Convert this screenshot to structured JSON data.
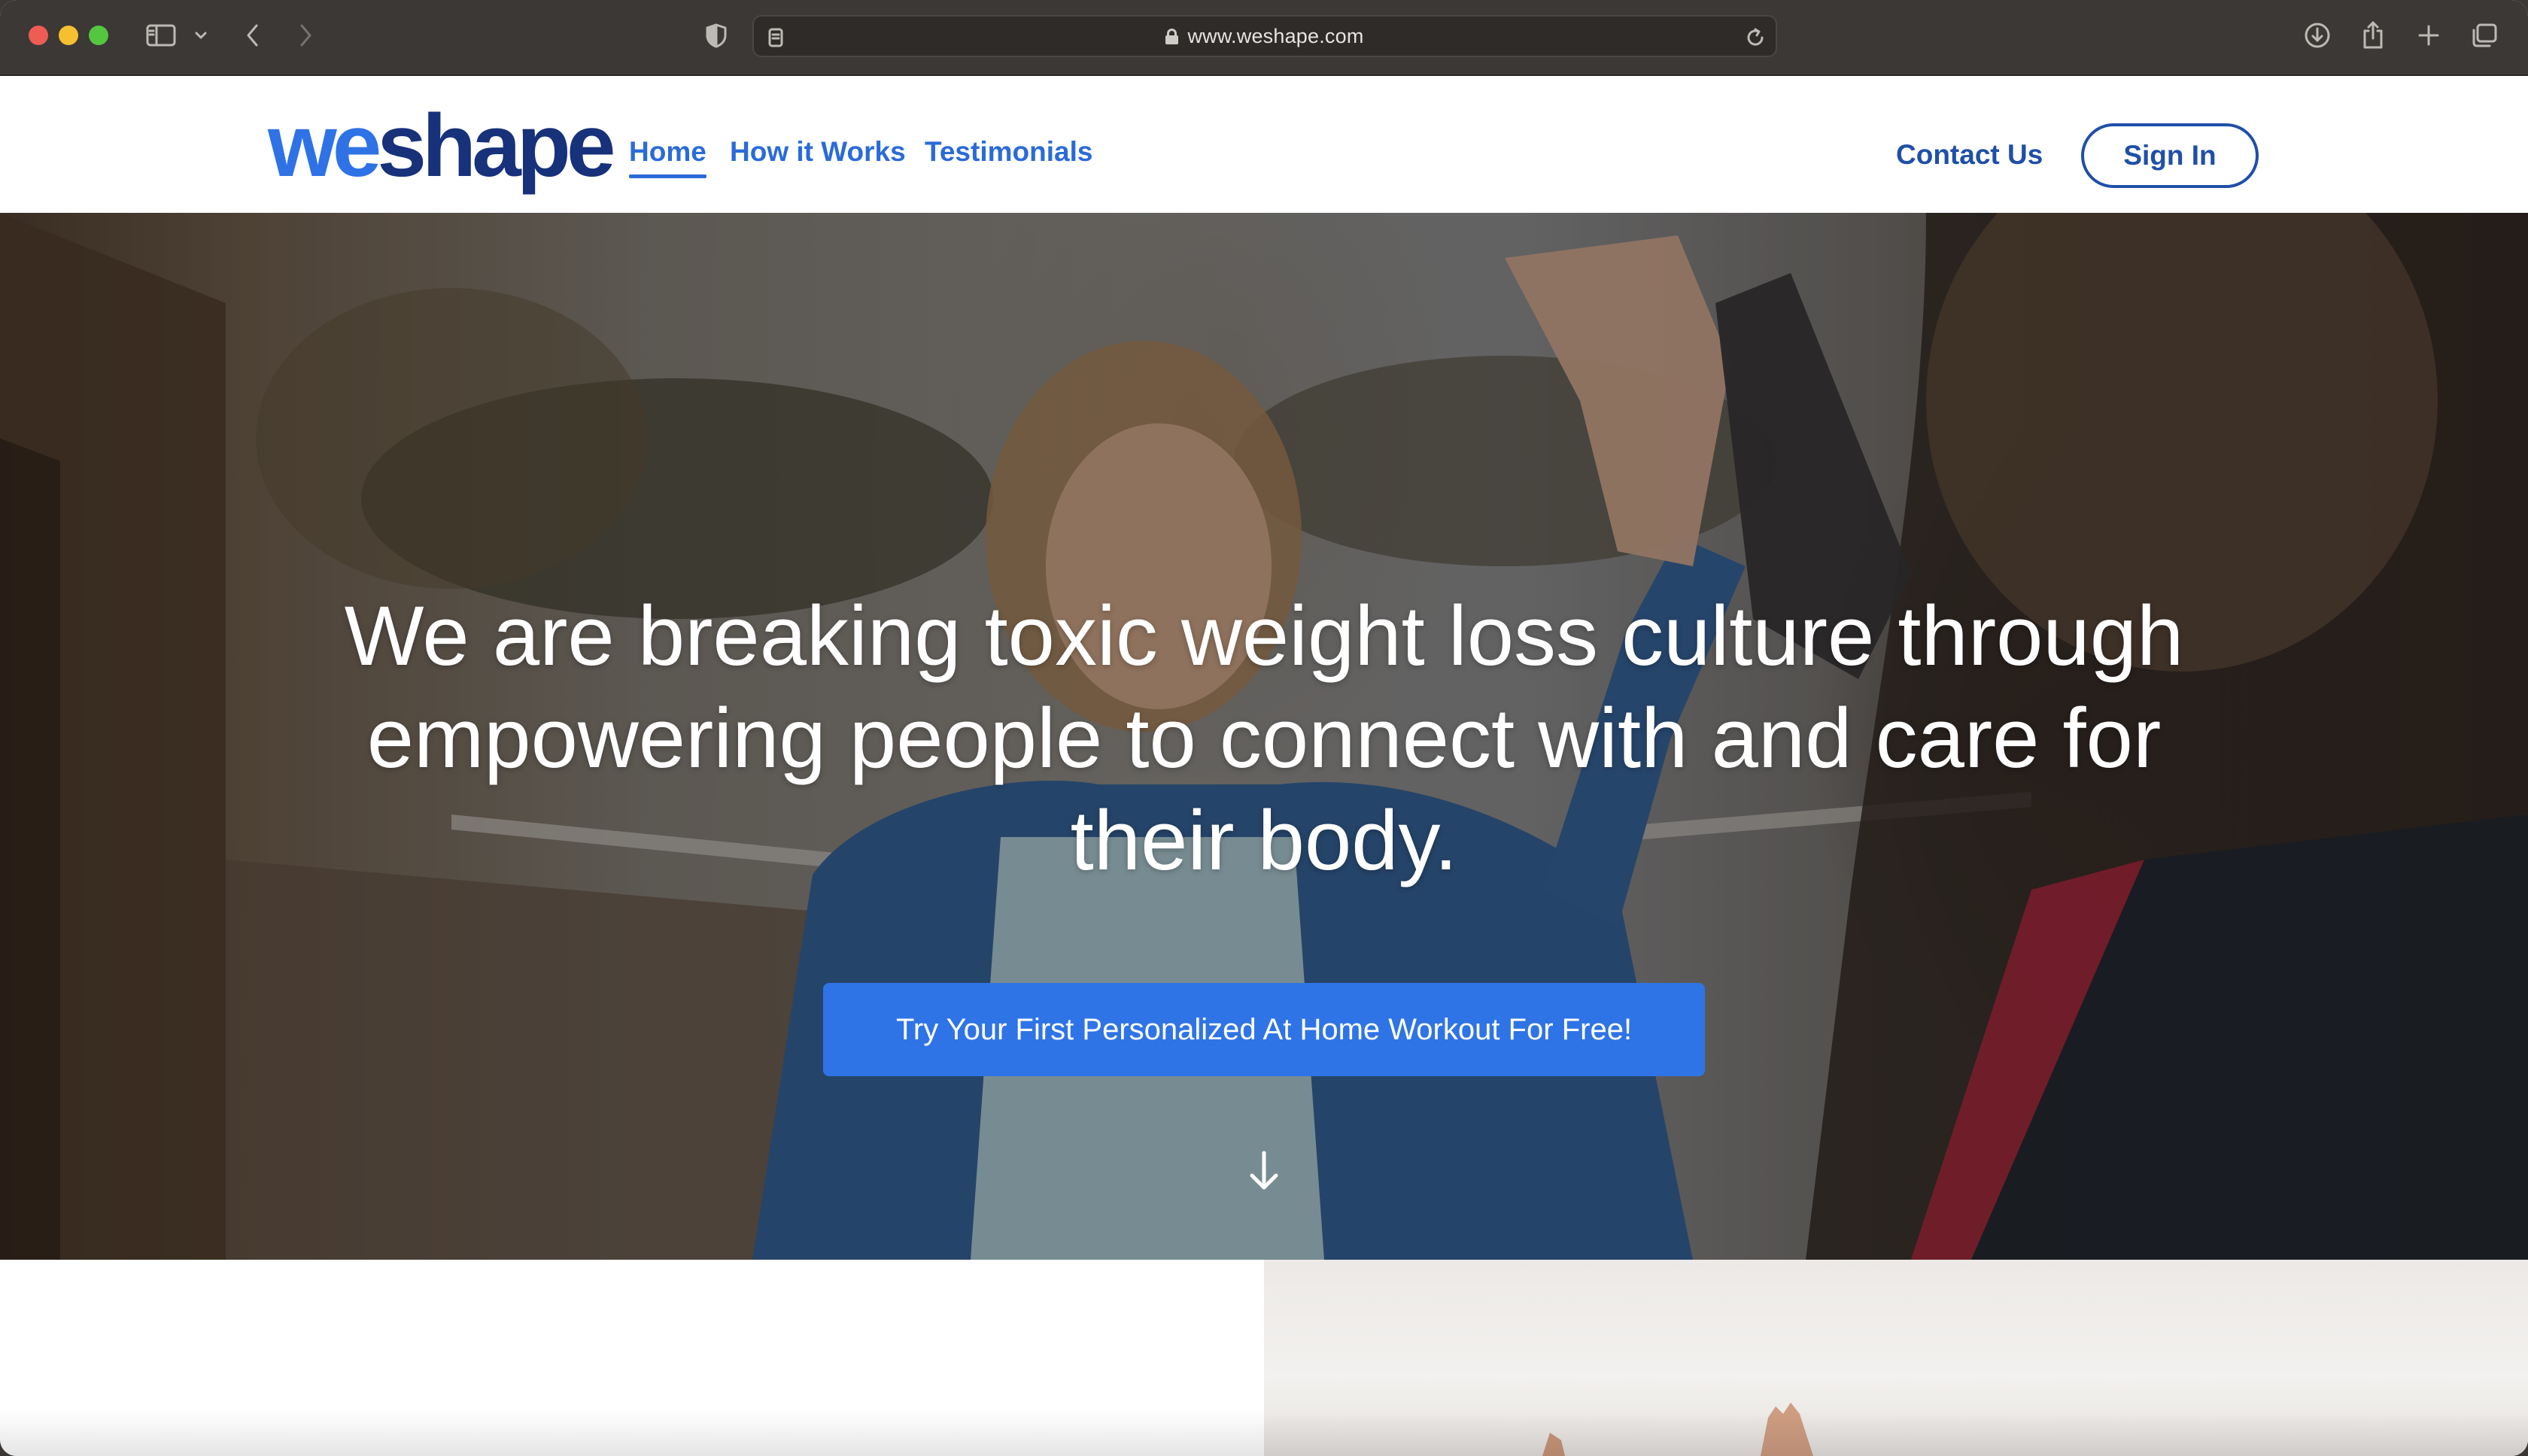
{
  "browser": {
    "url": "www.weshape.com",
    "icons": {
      "sidebar": "sidebar-icon",
      "back": "chevron-left-icon",
      "forward": "chevron-right-icon",
      "privacy": "shield-icon",
      "reader": "reader-icon",
      "reload": "reload-icon",
      "download": "download-icon",
      "share": "share-icon",
      "new_tab": "plus-icon",
      "tabs": "tabs-overview-icon"
    }
  },
  "header": {
    "logo": {
      "part1": "we",
      "part2": "shape"
    },
    "nav": [
      {
        "label": "Home",
        "active": true
      },
      {
        "label": "How it Works",
        "active": false
      },
      {
        "label": "Testimonials",
        "active": false
      }
    ],
    "contact_label": "Contact Us",
    "signin_label": "Sign In"
  },
  "hero": {
    "headline": "We are breaking toxic weight loss culture through empowering people to connect with and care for their body.",
    "cta_label": "Try Your First Personalized At Home Workout For Free!",
    "scroll_icon": "arrow-down-icon"
  },
  "colors": {
    "brand_blue": "#2e72e6",
    "brand_navy": "#17317a",
    "cta_blue": "#2f74e6",
    "nav_blue": "#2a6bd8"
  }
}
